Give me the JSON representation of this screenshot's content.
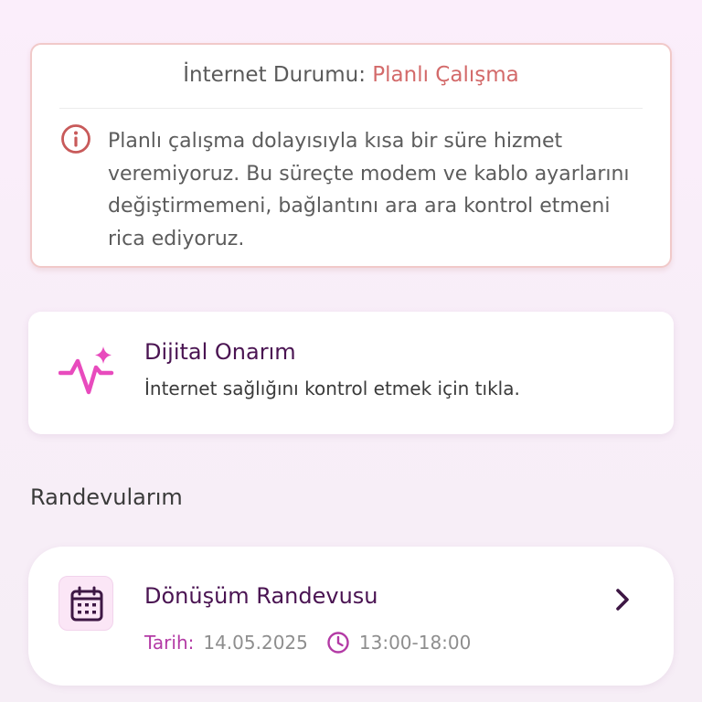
{
  "status": {
    "label": "İnternet Durumu",
    "separator": ":",
    "value": "Planlı Çalışma",
    "message": "Planlı çalışma dolayısıyla kısa bir süre hizmet veremiyoruz. Bu süreçte modem ve kablo ayarlarını değiştirmemeni, bağlantını ara ara kontrol etmeni rica ediyoruz.",
    "icon": "info-circle-icon",
    "accent_color": "#d36a6a"
  },
  "repair": {
    "title": "Dijital Onarım",
    "subtitle": "İnternet sağlığını kontrol etmek için tıkla.",
    "icon": "pulse-sparkle-icon",
    "icon_color": "#e84bbd"
  },
  "appointments": {
    "heading": "Randevularım",
    "items": [
      {
        "title": "Dönüşüm Randevusu",
        "date_label": "Tarih:",
        "date": "14.05.2025",
        "time": "13:00-18:00",
        "icon": "calendar-icon"
      }
    ]
  },
  "colors": {
    "brand_purple": "#4a1452",
    "pink_accent": "#b33aa5"
  }
}
